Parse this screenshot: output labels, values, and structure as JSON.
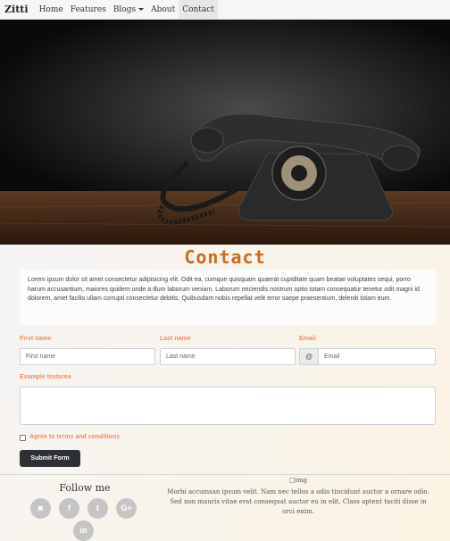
{
  "navbar": {
    "brand": "Zitti",
    "links": [
      "Home",
      "Features",
      "Blogs",
      "About",
      "Contact"
    ]
  },
  "hero": {
    "image_subject": "vintage rotary telephone on wooden table"
  },
  "contact": {
    "title": "Contact",
    "intro": "Lorem ipsum dolor sit amet consectetur adipisicing elit. Odit ea, cumque quisquam quaerat cupiditate quam beatae voluptates sequi, porro harum accusantium, maiores quidem unde a illum laborum veniam. Laborum reiciendis nostrum optio totam consequatur tenetur odit magni id dolorem, amet facilis ullam corrupti consectetur debitis. Quibusdam nobis repellat velit error saepe praesentium, deleniti totam eum."
  },
  "form": {
    "first_name": {
      "label": "First name",
      "placeholder": "First name"
    },
    "last_name": {
      "label": "Last name",
      "placeholder": "Last name"
    },
    "email": {
      "label": "Email",
      "addon": "@",
      "placeholder": "Email"
    },
    "textarea": {
      "label": "Example textarea"
    },
    "terms": {
      "label": "Agree to terms and conditions"
    },
    "submit": "Submit Form"
  },
  "footer": {
    "follow": "Follow me",
    "social_icons": [
      "instagram-icon",
      "facebook-icon",
      "twitter-icon",
      "google-plus-icon",
      "linkedin-icon"
    ],
    "social_glyphs": [
      "◙",
      "f",
      "t",
      "G+",
      "in"
    ],
    "image_alt": "img",
    "text": "Morbi accumsan ipsum velit. Nam nec tellus a odio tincidunt auctor a ornare odio. Sed non mauris vitae erat consequat auctor eu in elit. Class aptent taciti disse in orci enim."
  },
  "colors": {
    "accent": "#d0691c",
    "label": "#f08a5d",
    "button": "#2d3035",
    "social": "#c5c5c5"
  }
}
